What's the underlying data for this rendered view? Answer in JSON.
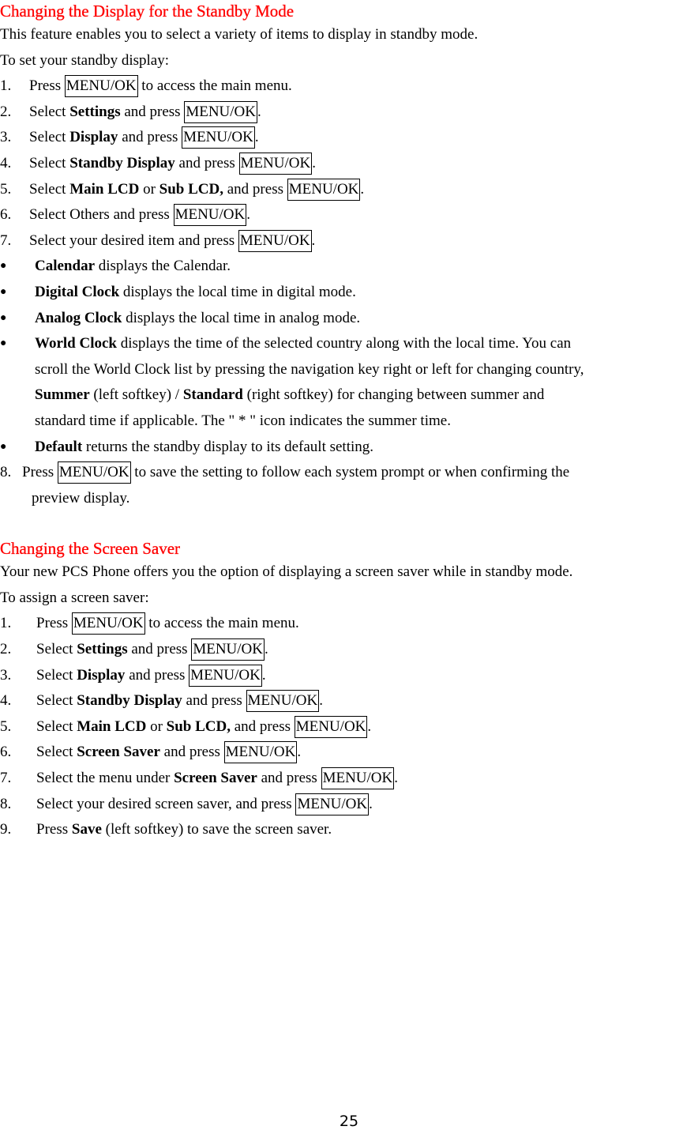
{
  "section1": {
    "title": "Changing the Display for the Standby Mode",
    "intro": "This feature enables you to select a variety of items to display in standby mode.",
    "lead": "To set your standby display:",
    "key_label": "MENU/OK",
    "steps": [
      {
        "num": "1.",
        "a": "Press ",
        "key": "MENU/OK",
        "b": " to access the main menu."
      },
      {
        "num": "2.",
        "a": "Select ",
        "bold": "Settings",
        "c": " and press ",
        "key": "MENU/OK",
        "end": "."
      },
      {
        "num": "3.",
        "a": "Select ",
        "bold": "Display",
        "c": " and press ",
        "key": "MENU/OK",
        "end": "."
      },
      {
        "num": "4.",
        "a": "Select ",
        "bold": "Standby Display",
        "c": " and press ",
        "key": "MENU/OK",
        "end": "."
      },
      {
        "num": "5.",
        "a": "Select ",
        "bold": "Main LCD",
        "or": " or ",
        "bold2": "Sub LCD,",
        "c": " and press ",
        "key": "MENU/OK",
        "end": "."
      },
      {
        "num": "6.",
        "a": "Select Others and press ",
        "key": "MENU/OK",
        "end": "."
      },
      {
        "num": "7.",
        "a": "Select your desired item and press ",
        "key": "MENU/OK",
        "end": "."
      }
    ],
    "bullets": [
      {
        "bold": "Calendar",
        "text": " displays the Calendar."
      },
      {
        "bold": "Digital Clock",
        "text": " displays the local time in digital mode."
      },
      {
        "bold": "Analog Clock",
        "text": " displays the local time in analog mode."
      },
      {
        "bold": "World Clock",
        "text": " displays the time of the selected country along with the local time. You can",
        "line2": "scroll the World Clock list by pressing the navigation key right or left for changing country,",
        "line3_bold1": "Summer",
        "line3_a": " (left softkey) / ",
        "line3_bold2": "Standard",
        "line3_b": " (right softkey) for changing between summer and",
        "line4": "standard time if applicable. The \" * \" icon indicates the summer time."
      },
      {
        "bold": "Default",
        "text": " returns the standby display to its default setting."
      }
    ],
    "step8": {
      "num": "8.",
      "a": "Press ",
      "key": "MENU/OK",
      "b": " to save the setting to follow each system prompt or when confirming the",
      "line2": "preview display."
    }
  },
  "section2": {
    "title": "Changing the Screen Saver",
    "intro": "Your new PCS Phone offers you the option of displaying a screen saver while in standby mode.",
    "lead": "To assign a screen saver:",
    "steps": [
      {
        "num": "1.",
        "a": "Press ",
        "key": "MENU/OK",
        "b": " to access the main menu."
      },
      {
        "num": "2.",
        "a": "Select ",
        "bold": "Settings",
        "c": " and press ",
        "key": "MENU/OK",
        "end": "."
      },
      {
        "num": "3.",
        "a": "Select ",
        "bold": "Display",
        "c": " and press ",
        "key": "MENU/OK",
        "end": "."
      },
      {
        "num": "4.",
        "a": "Select ",
        "bold": "Standby Display",
        "c": " and press ",
        "key": "MENU/OK",
        "end": "."
      },
      {
        "num": "5.",
        "a": "Select ",
        "bold": "Main LCD",
        "or": " or ",
        "bold2": "Sub LCD,",
        "c": " and press ",
        "key": "MENU/OK",
        "end": "."
      },
      {
        "num": "6.",
        "a": "Select ",
        "bold": "Screen Saver",
        "c": " and press ",
        "key": "MENU/OK",
        "end": "."
      },
      {
        "num": "7.",
        "a": "Select the menu under ",
        "bold": "Screen Saver",
        "c": " and press ",
        "key": "MENU/OK",
        "end": "."
      },
      {
        "num": "8.",
        "a": "Select your desired screen saver, and press ",
        "key": "MENU/OK",
        "end": "."
      },
      {
        "num": "9.",
        "a": "Press ",
        "bold": "Save",
        "c": " (left softkey) to save the screen saver."
      }
    ]
  },
  "bullet_glyph": "●",
  "page_number": "25",
  "colors": {
    "heading": "#ff0000",
    "text": "#000000"
  }
}
